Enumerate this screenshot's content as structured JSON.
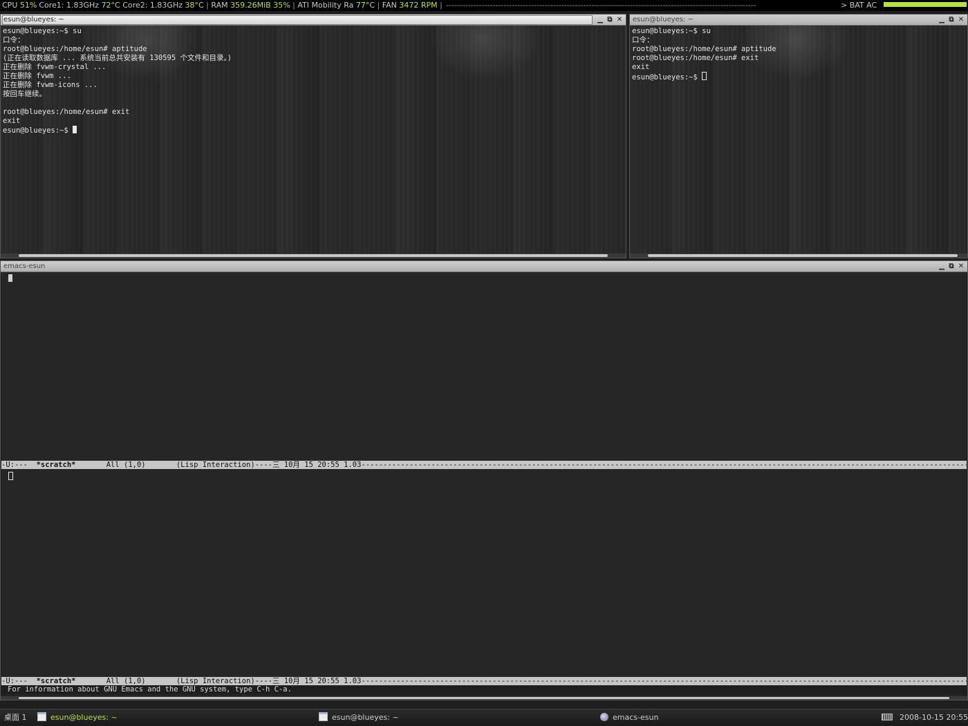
{
  "statusbar": {
    "cpu_label": "CPU",
    "cpu_val": "51%",
    "core1_label": "Core1:",
    "core1_freq": "1.83GHz",
    "core1_temp": "72°C",
    "core2_label": "Core2:",
    "core2_freq": "1.83GHz",
    "core2_temp": "38°C",
    "ram_label": "RAM",
    "ram_used": "359.26MiB",
    "ram_pct": "35%",
    "gpu_label": "ATI Mobility Ra",
    "gpu_temp": "77°C",
    "fan_label": "FAN",
    "fan_val": "3472",
    "fan_unit": "RPM",
    "sep": "|",
    "dashes": "-----------------------------------------------------------------------------------------------------------------",
    "arrow": ">",
    "bat_label": "BAT",
    "ac_label": "AC",
    "battery_level": 1.0,
    "accent_color": "#b6e04a"
  },
  "term1": {
    "title": "esun@blueyes: ~",
    "lines": [
      "esun@blueyes:~$ su",
      "口令：",
      "root@blueyes:/home/esun# aptitude",
      "(正在读取数据库 ... 系统当前总共安装有 130595 个文件和目录。)",
      "正在删除 fvwm-crystal ...",
      "正在删除 fvwm ...",
      "正在删除 fvwm-icons ...",
      "按回车继续。",
      "",
      "root@blueyes:/home/esun# exit",
      "exit"
    ],
    "prompt": "esun@blueyes:~$ "
  },
  "term2": {
    "title": "esun@blueyes: ~",
    "lines": [
      "esun@blueyes:~$ su",
      "口令：",
      "root@blueyes:/home/esun# aptitude",
      "root@blueyes:/home/esun# exit",
      "exit"
    ],
    "prompt": "esun@blueyes:~$ "
  },
  "emacs": {
    "title": "emacs-esun",
    "modeline": {
      "status": "-U:---  ",
      "buffer": "*scratch*",
      "position": "       All (1,0)       ",
      "mode": "(Lisp Interaction)----三 10月 15 20:55 1.03",
      "fill": "-----------------------------------------------------------------------------------------------------------------------------------------------------------"
    },
    "echo": "For information about GNU Emacs and the GNU system, type C-h C-a."
  },
  "window_buttons": {
    "minimize": "▁",
    "maximize": "⧉",
    "close": "✕"
  },
  "taskbar": {
    "desktop": "桌面 1",
    "tasks": [
      "esun@blueyes: ~",
      "esun@blueyes: ~",
      "emacs-esun"
    ],
    "clock": "2008-10-15  20:55"
  }
}
